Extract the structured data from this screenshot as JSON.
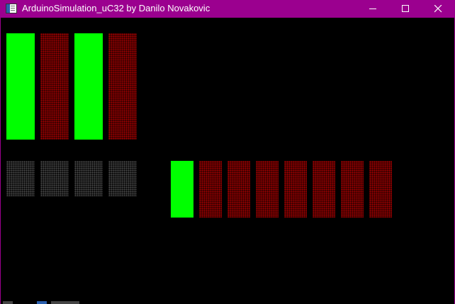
{
  "window": {
    "title": "ArduinoSimulation_uC32 by Danilo Novakovic",
    "icon": "app-window-icon",
    "controls": [
      "minimize-icon",
      "maximize-icon",
      "close-icon"
    ]
  },
  "colors": {
    "titlebar": "#9b008f",
    "led_on": "#00ff00",
    "led_off": "#a10000",
    "led_dim": "#4a4a4a",
    "background": "#000000"
  },
  "panels": {
    "top_leds": {
      "states": [
        "on",
        "off",
        "on",
        "off"
      ]
    },
    "switches": {
      "states": [
        "dim",
        "dim",
        "dim",
        "dim"
      ]
    },
    "bottom_leds": {
      "states": [
        "on",
        "off",
        "off",
        "off",
        "off",
        "off",
        "off",
        "off"
      ]
    }
  }
}
